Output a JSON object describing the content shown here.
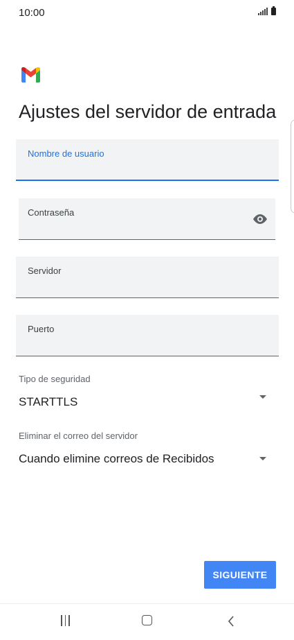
{
  "status_bar": {
    "time": "10:00"
  },
  "app": {
    "logo": "gmail-logo"
  },
  "page": {
    "title": "Ajustes del servidor de entrada"
  },
  "fields": {
    "username": {
      "label": "Nombre de usuario",
      "value": ""
    },
    "password": {
      "label": "Contraseña",
      "value": ""
    },
    "server": {
      "label": "Servidor",
      "value": ""
    },
    "port": {
      "label": "Puerto",
      "value": ""
    }
  },
  "security": {
    "label": "Tipo de seguridad",
    "value": "STARTTLS"
  },
  "delete_policy": {
    "label": "Eliminar el correo del servidor",
    "value": "Cuando elimine correos de Recibidos"
  },
  "actions": {
    "next_label": "SIGUIENTE"
  },
  "nav": {
    "recent": "recent-apps-icon",
    "home": "home-icon",
    "back": "back-icon"
  },
  "colors": {
    "accent": "#1a73e8",
    "button": "#4285f4",
    "field_bg": "#f1f3f4"
  }
}
